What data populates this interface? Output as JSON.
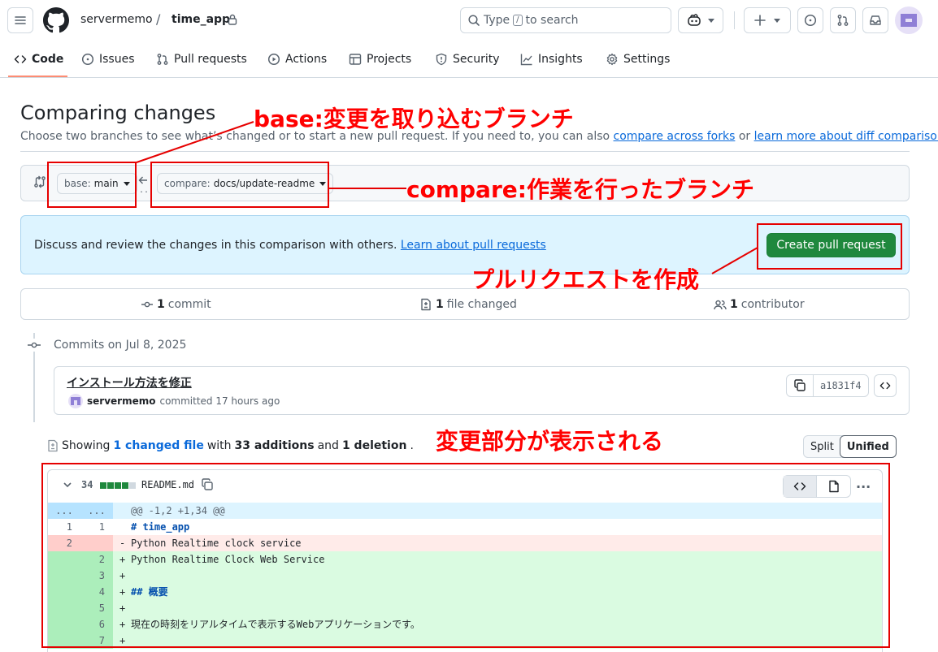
{
  "header": {
    "owner": "servermemo",
    "separator": "/",
    "repo": "time_app",
    "search_placeholder": "Type",
    "search_key": "/",
    "search_suffix": "to search"
  },
  "nav": {
    "tabs": [
      {
        "label": "Code",
        "icon": "code-icon",
        "active": true
      },
      {
        "label": "Issues",
        "icon": "issue-icon"
      },
      {
        "label": "Pull requests",
        "icon": "pull-request-icon"
      },
      {
        "label": "Actions",
        "icon": "play-icon"
      },
      {
        "label": "Projects",
        "icon": "table-icon"
      },
      {
        "label": "Security",
        "icon": "shield-icon"
      },
      {
        "label": "Insights",
        "icon": "graph-icon"
      },
      {
        "label": "Settings",
        "icon": "gear-icon"
      }
    ]
  },
  "page": {
    "title": "Comparing changes",
    "subtitle_prefix": "Choose two branches to see what’s changed or to start a new pull request. If you need to, you can also",
    "link_forks": "compare across forks",
    "subtitle_or": "or",
    "link_learn": "learn more about diff comparisons",
    "subtitle_end": "."
  },
  "compare": {
    "base_prefix": "base:",
    "base_value": "main",
    "compare_prefix": "compare:",
    "compare_value": "docs/update-readme",
    "dots": "..."
  },
  "banner": {
    "text": "Discuss and review the changes in this comparison with others.",
    "link": "Learn about pull requests",
    "button": "Create pull request"
  },
  "stats": {
    "commits_count": "1",
    "commits_label": "commit",
    "files_count": "1",
    "files_label": "file changed",
    "contributors_count": "1",
    "contributors_label": "contributor"
  },
  "commits": {
    "heading": "Commits on Jul 8, 2025",
    "title": "インストール方法を修正",
    "author": "servermemo",
    "meta": "committed 17 hours ago",
    "sha": "a1831f4"
  },
  "summary": {
    "prefix": "Showing",
    "files": "1 changed file",
    "with": "with",
    "additions": "33 additions",
    "and": "and",
    "deletions": "1 deletion",
    "end": ".",
    "split": "Split",
    "unified": "Unified"
  },
  "diff": {
    "count": "34",
    "filename": "README.md",
    "more": "···",
    "rows": [
      {
        "type": "hunk",
        "l1": "...",
        "l2": "...",
        "text": "@@ -1,2 +1,34 @@"
      },
      {
        "type": "ctx",
        "l1": "1",
        "l2": "1",
        "marker": " ",
        "text": "# time_app",
        "heading": true
      },
      {
        "type": "del",
        "l1": "2",
        "l2": "",
        "marker": "-",
        "text": "Python Realtime clock service"
      },
      {
        "type": "add",
        "l1": "",
        "l2": "2",
        "marker": "+",
        "text": "Python Realtime Clock Web Service"
      },
      {
        "type": "add",
        "l1": "",
        "l2": "3",
        "marker": "+",
        "text": ""
      },
      {
        "type": "add",
        "l1": "",
        "l2": "4",
        "marker": "+",
        "text": "## 概要",
        "heading": true
      },
      {
        "type": "add",
        "l1": "",
        "l2": "5",
        "marker": "+",
        "text": ""
      },
      {
        "type": "add",
        "l1": "",
        "l2": "6",
        "marker": "+",
        "text": "現在の時刻をリアルタイムで表示するWebアプリケーションです。"
      },
      {
        "type": "add",
        "l1": "",
        "l2": "7",
        "marker": "+",
        "text": ""
      }
    ]
  },
  "annotations": {
    "base": "base:変更を取り込むブランチ",
    "compare": "compare:作業を行ったブランチ",
    "create": "プルリクエストを作成",
    "diff": "変更部分が表示される"
  },
  "colors": {
    "accent": "#0969da",
    "primary_button": "#1f883d",
    "annotation": "#ff0000",
    "tab_underline": "#fd8c73"
  }
}
